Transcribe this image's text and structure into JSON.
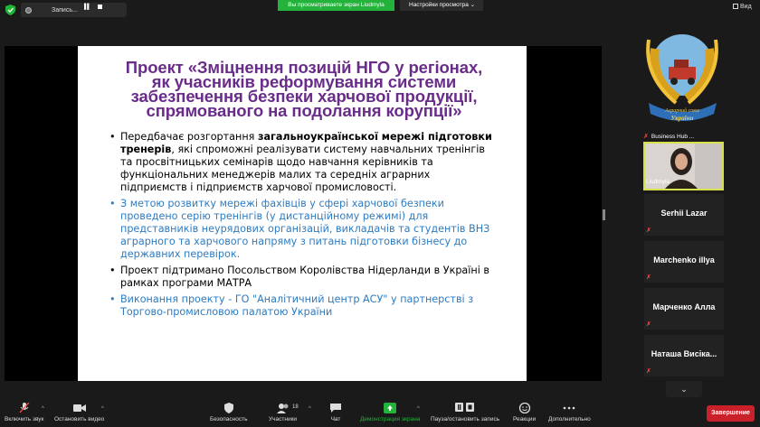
{
  "topbar": {
    "record_label": "Запись...",
    "view_banner": "Вы просматриваете экран Liudmyla",
    "view_options": "Настройки просмотра",
    "view_button": "Вид"
  },
  "slide": {
    "title_lines": [
      "Проект «Зміцнення позицій НГО у регіонах,",
      "як учасників реформування системи",
      "забезпечення безпеки харчової продукції,",
      "спрямованого на подолання корупції»"
    ],
    "bullet_marker": "•",
    "bullet1_a": "Передбачає розгортання ",
    "bullet1_b": "загальноукраїнської мережі підготовки тренерів",
    "bullet1_c": ", які спроможні реалізувати систему навчальних тренінгів та просвітницьких семінарів щодо навчання керівників та функціональних менеджерів малих та середніх аграрних підприємств і підприємств харчової промисловості.",
    "bullet2": "З метою розвитку мережі фахівців у сфері харчової безпеки проведено серію тренінгів (у дистанційному режимі) для представників неурядових організацій, викладачів та студентів ВНЗ аграрного та харчового напряму з питань підготовки бізнесу до державних перевірок.",
    "bullet3": "Проект підтримано Посольством Королівства Нідерланди в Україні в рамках програми МАТРА",
    "bullet4": "Виконання проекту -  ГО \"Аналітичний центр АСУ\" у партнерстві з Торгово-промисловою палатою України"
  },
  "panel": {
    "logo_text_top": "Аграрний союз",
    "logo_text_bottom": "України",
    "tile1_label": "Business Hub ...",
    "tile2_label": "Liudmyla",
    "participants": [
      "Serhii Lazar",
      "Marchenko illya",
      "Марченко Алла",
      "Наташа  Висіка..."
    ]
  },
  "toolbar": {
    "mute": "Включить звук",
    "video": "Остановить видео",
    "security": "Безопасность",
    "participants": "Участники",
    "participants_count": "18",
    "chat": "Чат",
    "share": "Демонстрация экрана",
    "pause_share": "Пауза/остановить запись",
    "reactions": "Реакции",
    "more": "Дополнительно",
    "end": "Завершение"
  },
  "colors": {
    "accent_green": "#23b33b",
    "end_red": "#c9202a",
    "title_purple": "#6a2c8a",
    "bullet_blue": "#2e7cc2",
    "active_border": "#d6e04a"
  }
}
